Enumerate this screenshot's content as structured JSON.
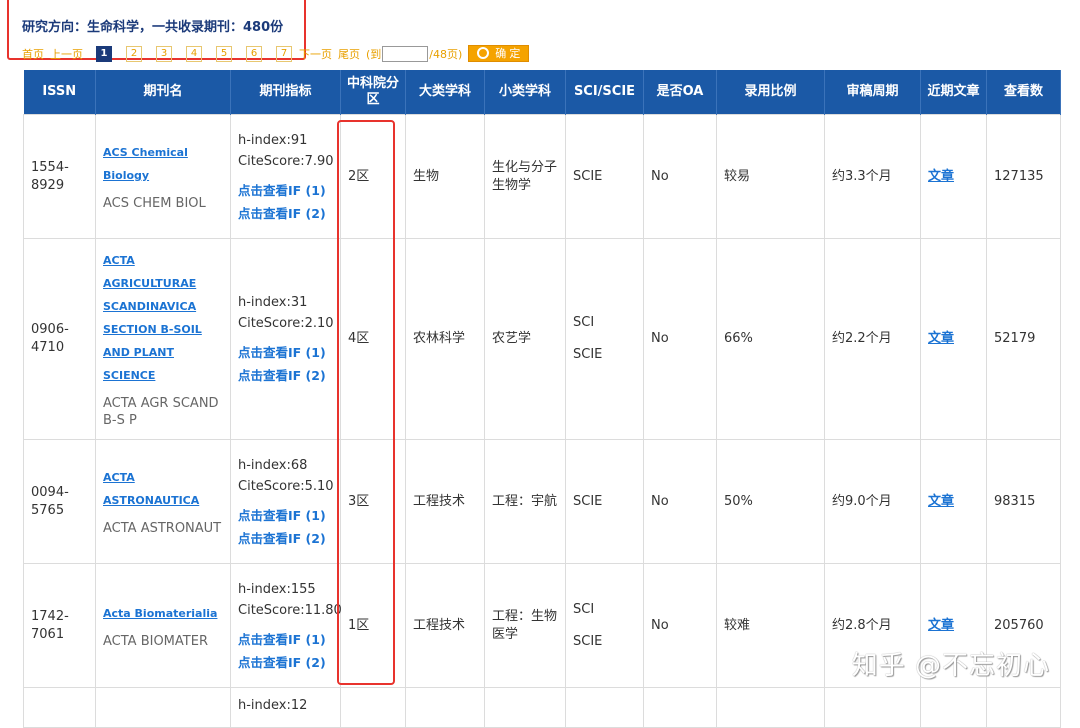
{
  "header": {
    "research_label": "研究方向：生命科学，一共收录期刊：480份"
  },
  "pager": {
    "first": "首页",
    "prev": "上一页",
    "pages": [
      "1",
      "2",
      "3",
      "4",
      "5",
      "6",
      "7"
    ],
    "next": "下一页",
    "last": "尾页",
    "goto_prefix": "(到",
    "goto_suffix": "/48页)",
    "confirm": "确 定"
  },
  "table": {
    "headers": [
      "ISSN",
      "期刊名",
      "期刊指标",
      "中科院分区",
      "大类学科",
      "小类学科",
      "SCI/SCIE",
      "是否OA",
      "录用比例",
      "审稿周期",
      "近期文章",
      "查看数"
    ],
    "rows": [
      {
        "issn": "1554-8929",
        "name_lines": [
          "ACS Chemical",
          "Biology"
        ],
        "abbr": "ACS CHEM BIOL",
        "h_index": "h-index:91",
        "citescore": "CiteScore:7.90",
        "if1": "点击查看IF (1)",
        "if2": "点击查看IF (2)",
        "zone": "2区",
        "major": "生物",
        "minor": "生化与分子生物学",
        "sci": [
          "SCIE"
        ],
        "oa": "No",
        "ratio": "较易",
        "cycle": "约3.3个月",
        "article": "文章",
        "views": "127135"
      },
      {
        "issn": "0906-4710",
        "name_lines": [
          "ACTA",
          "AGRICULTURAE",
          "SCANDINAVICA",
          "SECTION B-SOIL",
          "AND PLANT",
          "SCIENCE"
        ],
        "abbr": "ACTA AGR SCAND B-S P",
        "h_index": "h-index:31",
        "citescore": "CiteScore:2.10",
        "if1": "点击查看IF (1)",
        "if2": "点击查看IF (2)",
        "zone": "4区",
        "major": "农林科学",
        "minor": "农艺学",
        "sci": [
          "SCI",
          "SCIE"
        ],
        "oa": "No",
        "ratio": "66%",
        "cycle": "约2.2个月",
        "article": "文章",
        "views": "52179"
      },
      {
        "issn": "0094-5765",
        "name_lines": [
          "ACTA",
          "ASTRONAUTICA"
        ],
        "abbr": "ACTA ASTRONAUT",
        "h_index": "h-index:68",
        "citescore": "CiteScore:5.10",
        "if1": "点击查看IF (1)",
        "if2": "点击查看IF (2)",
        "zone": "3区",
        "major": "工程技术",
        "minor": "工程：宇航",
        "sci": [
          "SCIE"
        ],
        "oa": "No",
        "ratio": "50%",
        "cycle": "约9.0个月",
        "article": "文章",
        "views": "98315"
      },
      {
        "issn": "1742-7061",
        "name_lines": [
          "Acta Biomaterialia"
        ],
        "abbr": "ACTA BIOMATER",
        "h_index": "h-index:155",
        "citescore": "CiteScore:11.80",
        "if1": "点击查看IF (1)",
        "if2": "点击查看IF (2)",
        "zone": "1区",
        "major": "工程技术",
        "minor": "工程：生物医学",
        "sci": [
          "SCI",
          "SCIE"
        ],
        "oa": "No",
        "ratio": "较难",
        "cycle": "约2.8个月",
        "article": "文章",
        "views": "205760"
      },
      {
        "h_index": "h-index:12"
      }
    ]
  },
  "watermark": "知乎 @不忘初心"
}
